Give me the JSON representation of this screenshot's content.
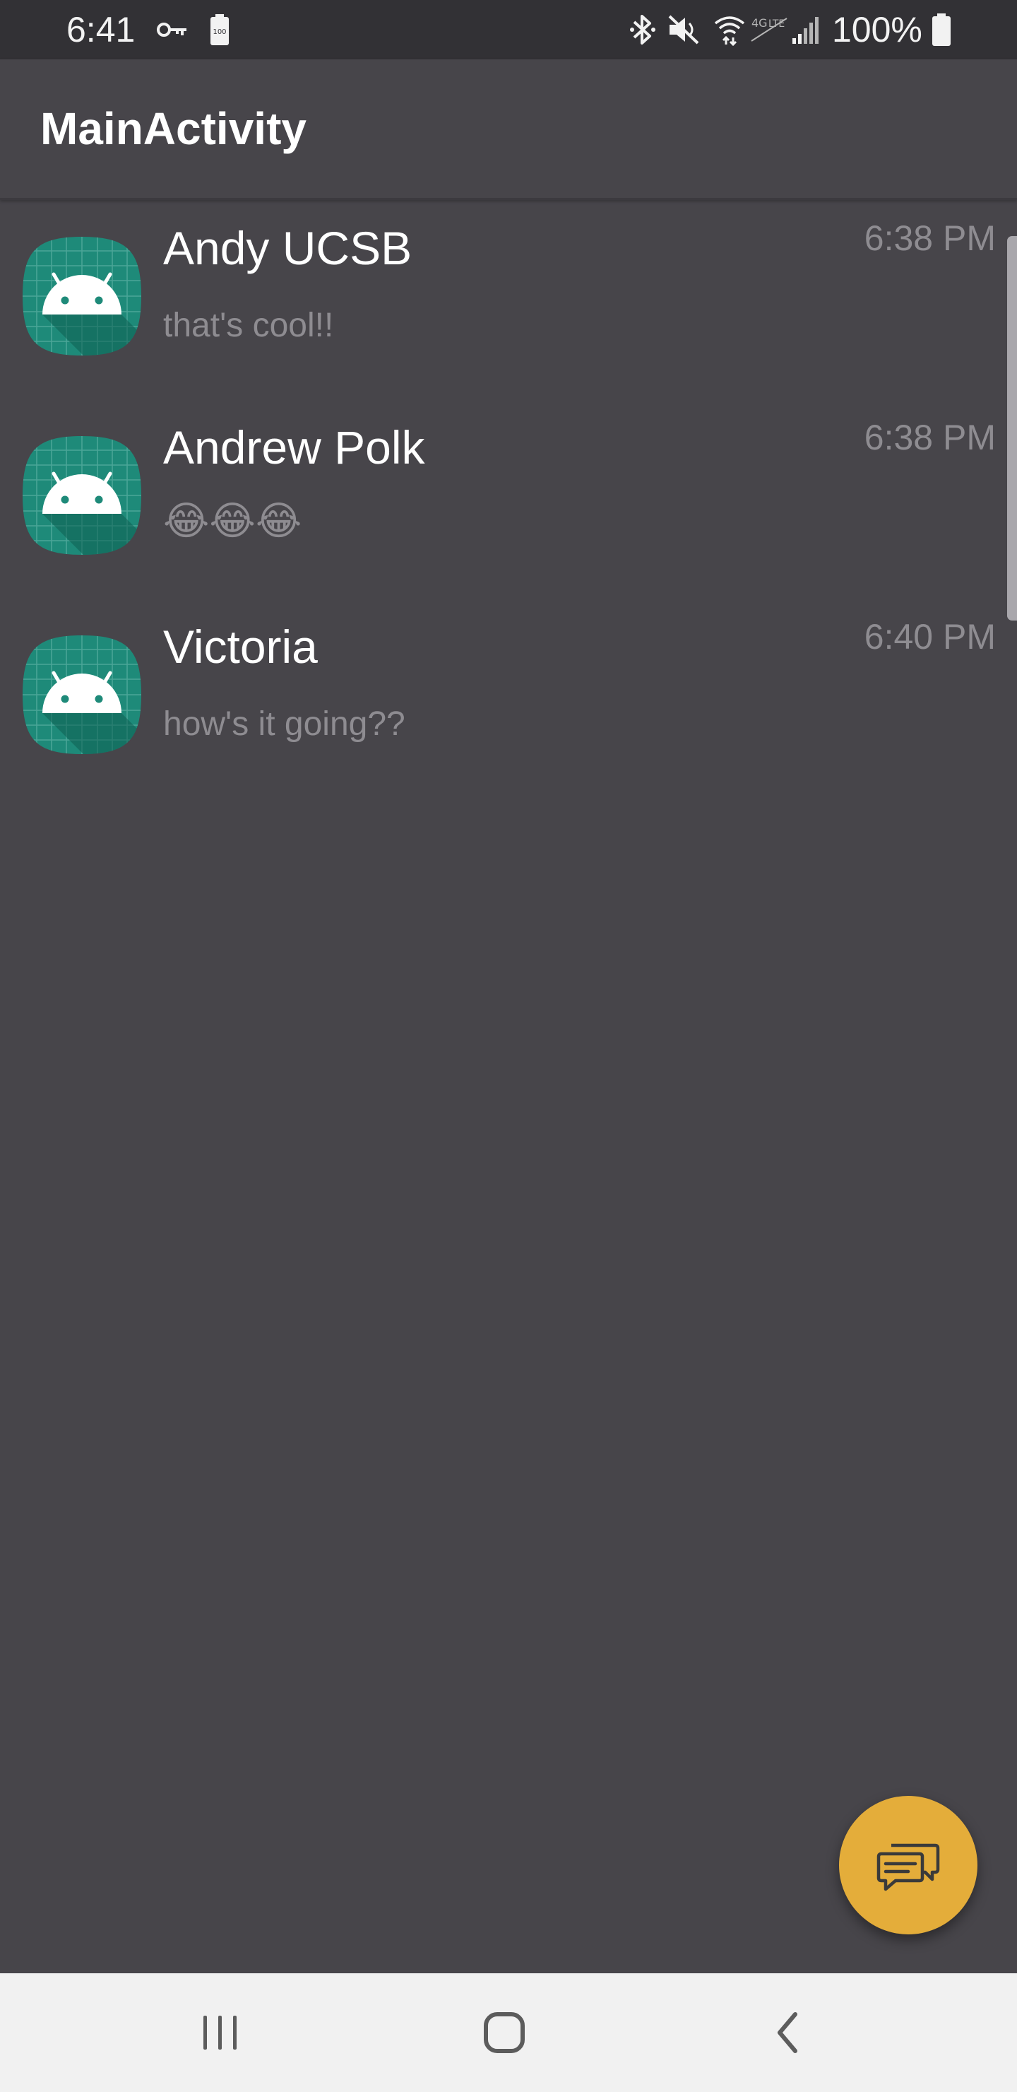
{
  "status_bar": {
    "time": "6:41",
    "battery_percent": "100%",
    "icons": [
      "vpn-key-icon",
      "battery-saver-icon",
      "bluetooth-icon",
      "mute-icon",
      "wifi-icon",
      "lte-icon",
      "signal-icon",
      "battery-icon"
    ]
  },
  "app_bar": {
    "title": "MainActivity"
  },
  "conversations": [
    {
      "name": "Andy UCSB",
      "preview": "that's cool!!",
      "time": "6:38 PM"
    },
    {
      "name": "Andrew Polk",
      "preview": "😂😂😂",
      "time": "6:38 PM"
    },
    {
      "name": "Victoria",
      "preview": "how's it going??",
      "time": "6:40 PM"
    }
  ],
  "fab": {
    "icon": "new-message-icon"
  },
  "nav_bar": {
    "buttons": [
      "recent-apps-icon",
      "home-icon",
      "back-icon"
    ]
  },
  "colors": {
    "background": "#47454a",
    "status_bar": "#323135",
    "accent": "#e4ad3a",
    "avatar": "#1e8a79",
    "nav_bar": "#f1f1f1"
  }
}
